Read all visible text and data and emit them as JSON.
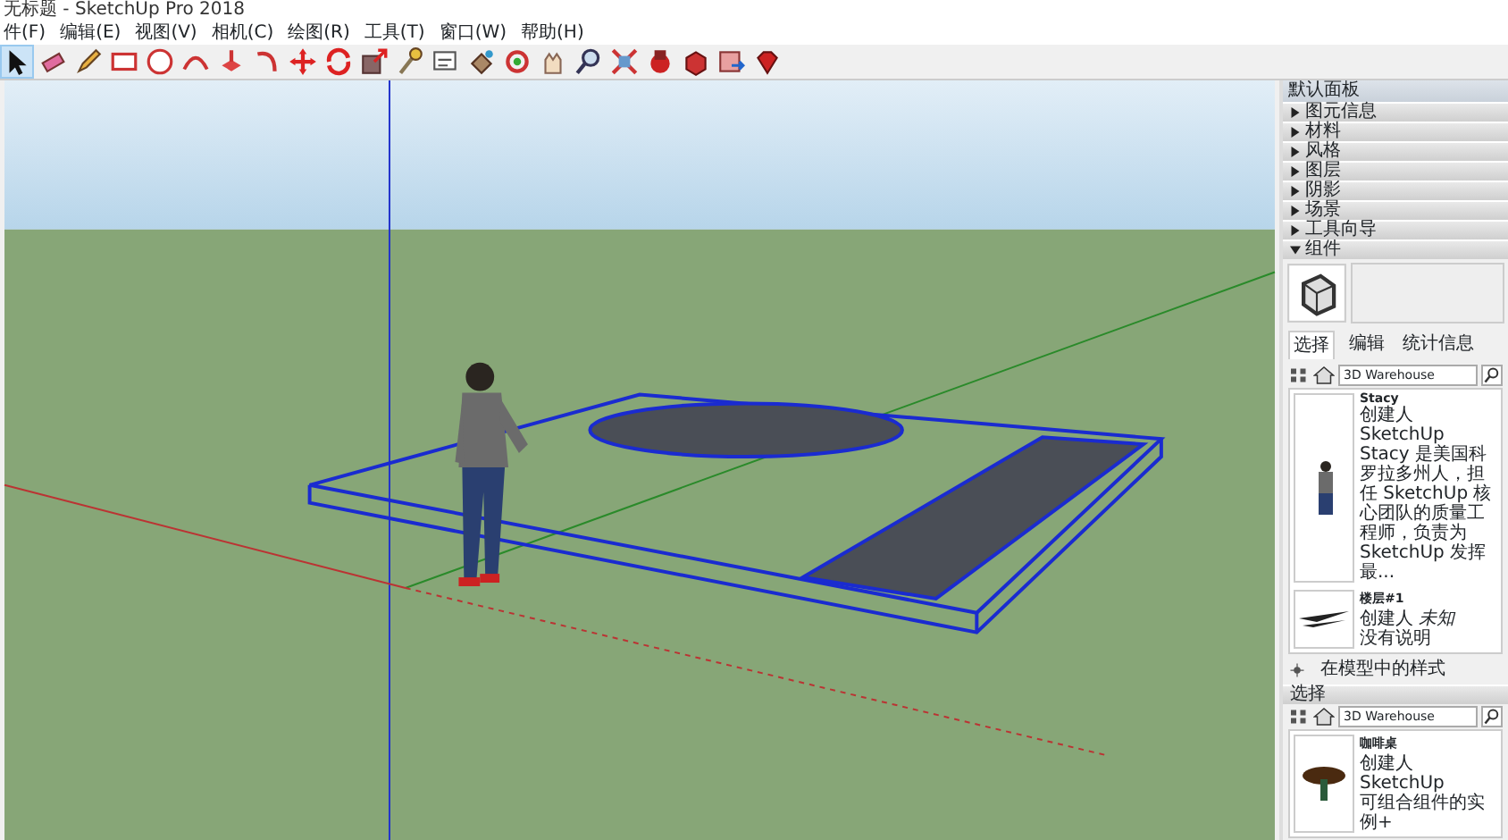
{
  "window": {
    "title": "无标题 - SketchUp Pro 2018"
  },
  "menu": [
    "件(F)",
    "编辑(E)",
    "视图(V)",
    "相机(C)",
    "绘图(R)",
    "工具(T)",
    "窗口(W)",
    "帮助(H)"
  ],
  "toolbar": [
    {
      "kind": "select",
      "selected": true
    },
    {
      "kind": "eraser",
      "selected": false
    },
    {
      "kind": "pencil",
      "selected": false
    },
    {
      "kind": "rect",
      "selected": false
    },
    {
      "kind": "circle",
      "selected": false
    },
    {
      "kind": "arc",
      "selected": false
    },
    {
      "kind": "pushpull",
      "selected": false
    },
    {
      "kind": "followme",
      "selected": false
    },
    {
      "kind": "move",
      "selected": false
    },
    {
      "kind": "rotate",
      "selected": false
    },
    {
      "kind": "scale",
      "selected": false
    },
    {
      "kind": "tape",
      "selected": false
    },
    {
      "kind": "text",
      "selected": false
    },
    {
      "kind": "paint",
      "selected": false
    },
    {
      "kind": "orbit",
      "selected": false
    },
    {
      "kind": "pan",
      "selected": false
    },
    {
      "kind": "zoom",
      "selected": false
    },
    {
      "kind": "extents",
      "selected": false
    },
    {
      "kind": "warehouse",
      "selected": false
    },
    {
      "kind": "components",
      "selected": false
    },
    {
      "kind": "share",
      "selected": false
    },
    {
      "kind": "ruby",
      "selected": false
    }
  ],
  "tray": {
    "title": "默认面板",
    "panels": [
      {
        "label": "图元信息",
        "expanded": false
      },
      {
        "label": "材料",
        "expanded": false
      },
      {
        "label": "风格",
        "expanded": false
      },
      {
        "label": "图层",
        "expanded": false
      },
      {
        "label": "阴影",
        "expanded": false
      },
      {
        "label": "场景",
        "expanded": false
      },
      {
        "label": "工具向导",
        "expanded": false
      },
      {
        "label": "组件",
        "expanded": true
      }
    ],
    "components": {
      "tabs": [
        {
          "label": "选择",
          "selected": true
        },
        {
          "label": "编辑",
          "selected": false
        },
        {
          "label": "统计信息",
          "selected": false
        }
      ],
      "search": {
        "value": "3D Warehouse"
      },
      "items": [
        {
          "kind": "person",
          "name": "Stacy",
          "author": "创建人 SketchUp",
          "description": "Stacy 是美国科罗拉多州人，担任 SketchUp 核心团队的质量工程师，负责为 SketchUp 发挥最..."
        },
        {
          "kind": "shadow",
          "name": "楼层#1",
          "author": "创建人 *未知*",
          "description": "没有说明"
        }
      ],
      "footer": "在模型中的样式"
    },
    "secondary": {
      "label": "选择",
      "search": {
        "value": "3D Warehouse"
      },
      "items": [
        {
          "kind": "table",
          "name": "咖啡桌",
          "author": "创建人 SketchUp",
          "description": "可组合组件的实例+"
        }
      ]
    }
  }
}
